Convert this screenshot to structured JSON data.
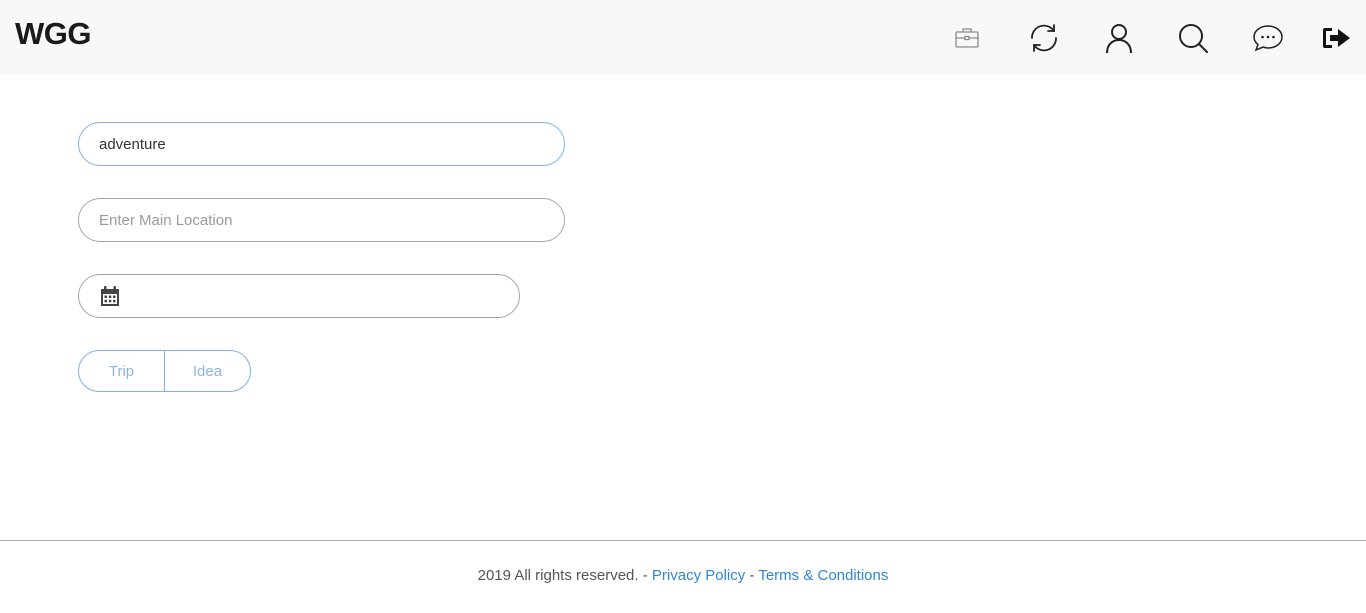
{
  "header": {
    "logo": "WGG",
    "icons": [
      "briefcase-icon",
      "sync-icon",
      "user-icon",
      "search-icon",
      "chat-icon",
      "logout-icon"
    ]
  },
  "form": {
    "keyword": {
      "value": "adventure",
      "placeholder": ""
    },
    "location": {
      "value": "",
      "placeholder": "Enter Main Location"
    },
    "date": {
      "value": "",
      "icon": "calendar-icon"
    },
    "type_options": [
      "Trip",
      "Idea"
    ]
  },
  "footer": {
    "copyright": "2019 All rights reserved.",
    "sep1": " - ",
    "privacy": "Privacy Policy",
    "sep2": " - ",
    "terms": "Terms & Conditions"
  },
  "colors": {
    "header_bg": "#f8f8f8",
    "accent": "#7fb0e6",
    "link": "#2f86d6"
  }
}
